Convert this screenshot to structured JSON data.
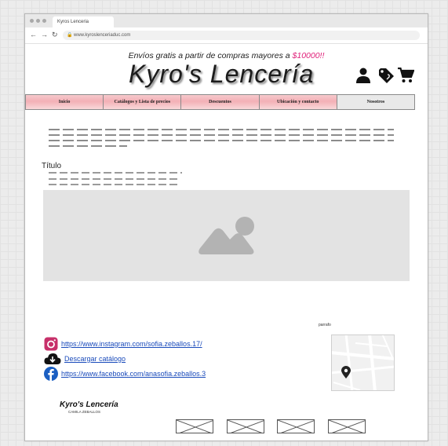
{
  "browser": {
    "tab_title": "Kyros Lenceria",
    "url": "www.kyroslenceriaduc.com"
  },
  "header": {
    "promo_prefix": "Envíos gratis a partir de compras mayores a ",
    "promo_price": "$10000!!",
    "logo": "Kyro's Lencería",
    "icons": [
      "user-icon",
      "tag-icon",
      "cart-icon"
    ]
  },
  "menu": {
    "items": [
      {
        "label": "Inicio"
      },
      {
        "label": "Catálogos y Lista de precios"
      },
      {
        "label": "Descuentos"
      },
      {
        "label": "Ubicación y contacto"
      },
      {
        "label": "Nosotros"
      }
    ]
  },
  "content": {
    "section_title": "Título",
    "hero_icon": "image-placeholder-icon"
  },
  "footer": {
    "map_label": "parrafo",
    "links": [
      {
        "icon": "instagram-icon",
        "text": "https://www.instagram.com/sofia.zeballos.17/"
      },
      {
        "icon": "cloud-download-icon",
        "text": "Descargar catálogo"
      },
      {
        "icon": "facebook-icon",
        "text": "https://www.facebook.com/anasofia.zeballos.3"
      }
    ],
    "logo": "Kyro's Lencería",
    "logo_sub": "CAMILA ZEBALLOS",
    "map_icon": "map-pin-icon"
  },
  "colors": {
    "accent_pink": "#e0217a",
    "menu_pink": "#f3b0b6",
    "link_blue": "#1a4bbb"
  }
}
